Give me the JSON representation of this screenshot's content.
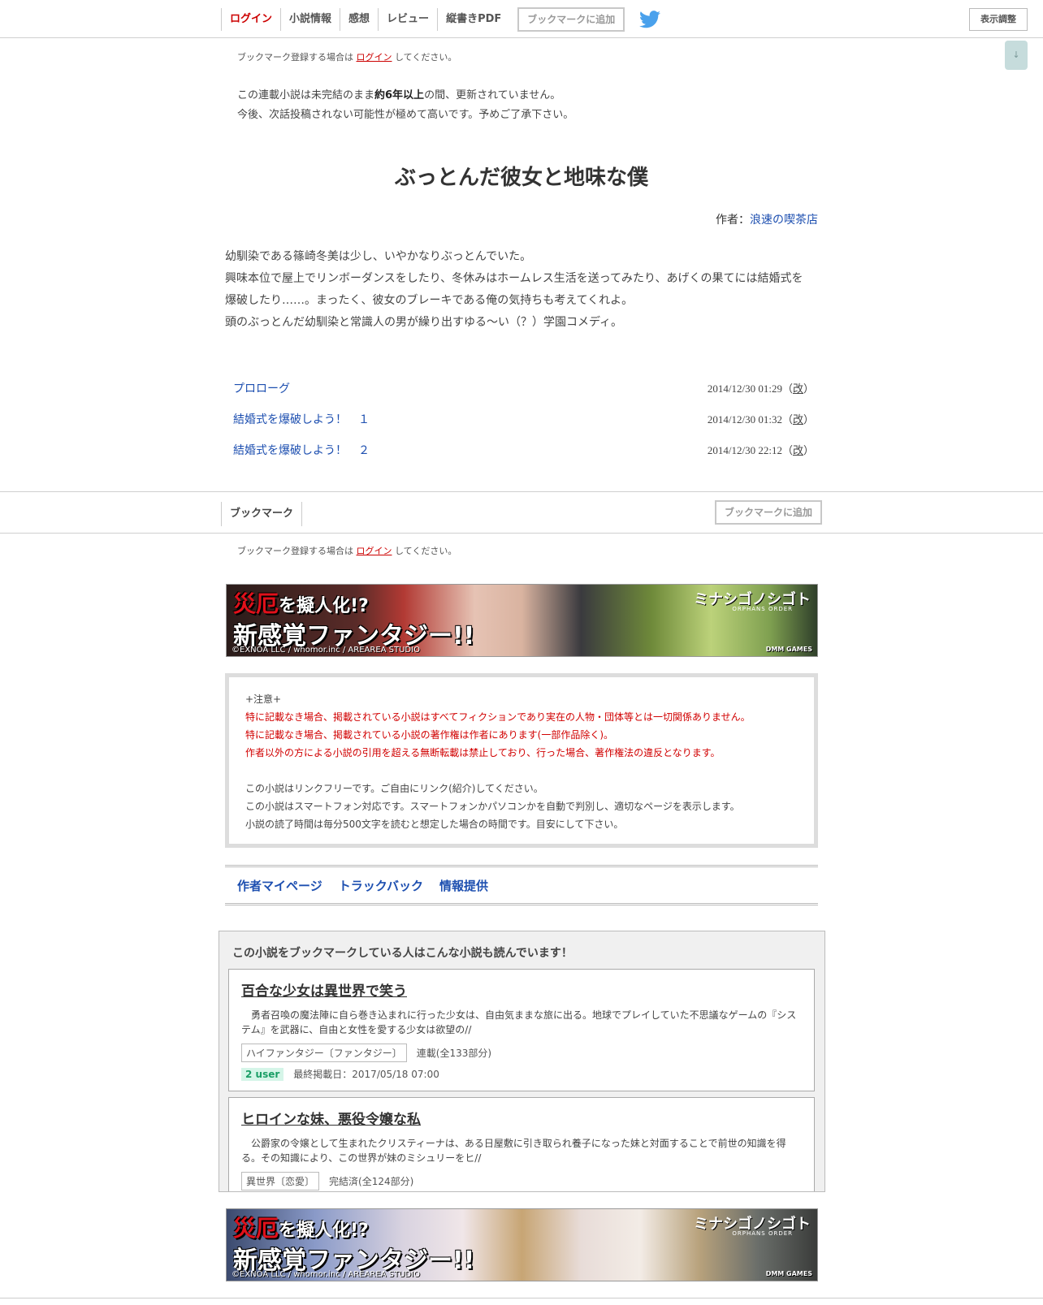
{
  "header": {
    "nav": [
      "ログイン",
      "小説情報",
      "感想",
      "レビュー",
      "縦書きPDF"
    ],
    "bookmark_button": "ブックマークに追加",
    "settings_button": "表示調整",
    "scroll_button": "↓"
  },
  "bookmark_note": {
    "prefix": "ブックマーク登録する場合は",
    "link": "ログイン",
    "suffix": "してください。"
  },
  "warning": {
    "line1_pre": "この連載小説は未完結のまま",
    "line1_bold": "約6年以上",
    "line1_post": "の間、更新されていません。",
    "line2": "今後、次話投稿されない可能性が極めて高いです。予めご了承下さい。"
  },
  "novel": {
    "title": "ぶっとんだ彼女と地味な僕",
    "author_label": "作者：",
    "author_name": "浪速の喫茶店",
    "summary": [
      "幼馴染である篠崎冬美は少し、いやかなりぶっとんでいた。",
      "興味本位で屋上でリンボーダンスをしたり、冬休みはホームレス生活を送ってみたり、あげくの果てには結婚式を爆破したり……。まったく、彼女のブレーキである俺の気持ちも考えてくれよ。",
      "頭のぶっとんだ幼馴染と常識人の男が繰り出すゆる～い（？）学園コメディ。"
    ]
  },
  "chapters": [
    {
      "title": "プロローグ",
      "date": "2014/12/30 01:29（",
      "kai": "改",
      "close": "）"
    },
    {
      "title": "結婚式を爆破しよう！　１",
      "date": "2014/12/30 01:32（",
      "kai": "改",
      "close": "）"
    },
    {
      "title": "結婚式を爆破しよう！　２",
      "date": "2014/12/30 22:12（",
      "kai": "改",
      "close": "）"
    }
  ],
  "bookmark_bar": {
    "label": "ブックマーク",
    "button": "ブックマークに追加"
  },
  "ad": {
    "red1": "災厄",
    "white1": "を擬人化!?",
    "line2": "新感覚ファンタジー!!",
    "copyright": "©EXNOA LLC / whomor.inc / AREAREA STUDIO",
    "brand": "ミナシゴノシゴト",
    "brand_sub": "ORPHANS ORDER",
    "dmm": "DMM GAMES"
  },
  "notice": {
    "heading": "+注意+",
    "red_lines": [
      "特に記載なき場合、掲載されている小説はすべてフィクションであり実在の人物・団体等とは一切関係ありません。",
      "特に記載なき場合、掲載されている小説の著作権は作者にあります(一部作品除く)。",
      "作者以外の方による小説の引用を超える無断転載は禁止しており、行った場合、著作権法の違反となります。"
    ],
    "lines": [
      "この小説はリンクフリーです。ご自由にリンク(紹介)してください。",
      "この小説はスマートフォン対応です。スマートフォンかパソコンかを自動で判別し、適切なページを表示します。",
      "小説の読了時間は毎分500文字を読むと想定した場合の時間です。目安にして下さい。"
    ]
  },
  "footer_links": [
    "作者マイページ",
    "トラックバック",
    "情報提供"
  ],
  "recommend": {
    "heading": "この小説をブックマークしている人はこんな小説も読んでいます！",
    "items": [
      {
        "title": "百合な少女は異世界で笑う",
        "desc": "勇者召喚の魔法陣に自ら巻き込まれに行った少女は、自由気ままな旅に出る。地球でプレイしていた不思議なゲームの『システム』を武器に、自由と女性を愛する少女は欲望の//",
        "genre": "ハイファンタジー〔ファンタジー〕",
        "status": "連載(全133部分)",
        "users": "2 user",
        "updated": "最終掲載日：2017/05/18 07:00"
      },
      {
        "title": "ヒロインな妹、悪役令嬢な私",
        "desc": "公爵家の令嬢として生まれたクリスティーナは、ある日屋敷に引き取られ養子になった妹と対面することで前世の知識を得る。その知識により、この世界が妹のミシュリーをヒ//",
        "genre": "異世界〔恋愛〕",
        "status": "完結済(全124部分)"
      }
    ]
  },
  "colors": {
    "link": "#1d4fb0",
    "login_red": "#cc0000",
    "notice_red": "#d10000",
    "user_badge": "#1a9e66"
  }
}
